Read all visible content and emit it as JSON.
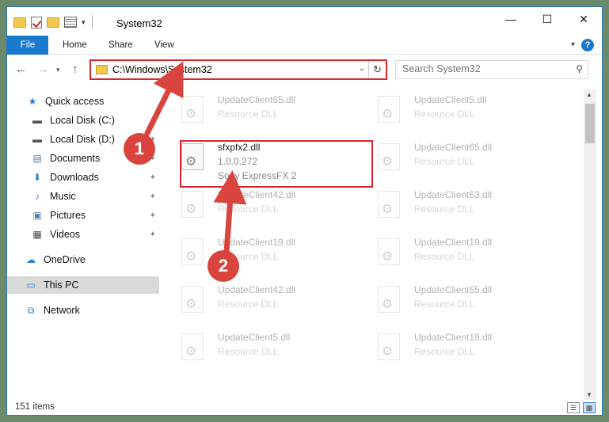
{
  "window": {
    "title": "System32"
  },
  "ribbon": {
    "tabs": [
      "File",
      "Home",
      "Share",
      "View"
    ],
    "help": "?"
  },
  "address": {
    "path": "C:\\Windows\\System32"
  },
  "search": {
    "placeholder": "Search System32"
  },
  "sidebar": {
    "items": [
      {
        "label": "Quick access",
        "icon": "star-icon",
        "pinned": false
      },
      {
        "label": "Local Disk (C:)",
        "icon": "drive-icon",
        "pinned": true
      },
      {
        "label": "Local Disk (D:)",
        "icon": "drive-icon",
        "pinned": true
      },
      {
        "label": "Documents",
        "icon": "documents-icon",
        "pinned": true
      },
      {
        "label": "Downloads",
        "icon": "download-icon",
        "pinned": true
      },
      {
        "label": "Music",
        "icon": "music-icon",
        "pinned": true
      },
      {
        "label": "Pictures",
        "icon": "pictures-icon",
        "pinned": true
      },
      {
        "label": "Videos",
        "icon": "videos-icon",
        "pinned": true
      },
      {
        "label": "OneDrive",
        "icon": "cloud-icon",
        "pinned": false
      },
      {
        "label": "This PC",
        "icon": "computer-icon",
        "pinned": false,
        "selected": true
      },
      {
        "label": "Network",
        "icon": "network-icon",
        "pinned": false
      }
    ]
  },
  "files": {
    "left": [
      {
        "name": "UpdateClient65.dll",
        "sub": "Resource DLL"
      },
      {
        "name": "sfxpfx2.dll",
        "version": "1.0.0.272",
        "sub": "Sony ExpressFX 2",
        "highlighted": true
      },
      {
        "name": "UpdateClient42.dll",
        "sub": "Resource DLL"
      },
      {
        "name": "UpdateClient19.dll",
        "sub": "Resource DLL"
      },
      {
        "name": "UpdateClient42.dll",
        "sub": "Resource DLL"
      },
      {
        "name": "UpdateClient5.dll",
        "sub": "Resource DLL"
      }
    ],
    "right": [
      {
        "name": "UpdateClient5.dll",
        "sub": "Resource DLL"
      },
      {
        "name": "UpdateClient65.dll",
        "sub": "Resource DLL"
      },
      {
        "name": "UpdateClient63.dll",
        "sub": "Resource DLL"
      },
      {
        "name": "UpdateClient19.dll",
        "sub": "Resource DLL"
      },
      {
        "name": "UpdateClient65.dll",
        "sub": "Resource DLL"
      },
      {
        "name": "UpdateClient19.dll",
        "sub": "Resource DLL"
      }
    ]
  },
  "status": {
    "count": "151 items"
  },
  "callouts": [
    "1",
    "2"
  ],
  "colors": {
    "accent": "#1979ca",
    "highlight": "#d9262d",
    "callout": "#d9453e"
  }
}
